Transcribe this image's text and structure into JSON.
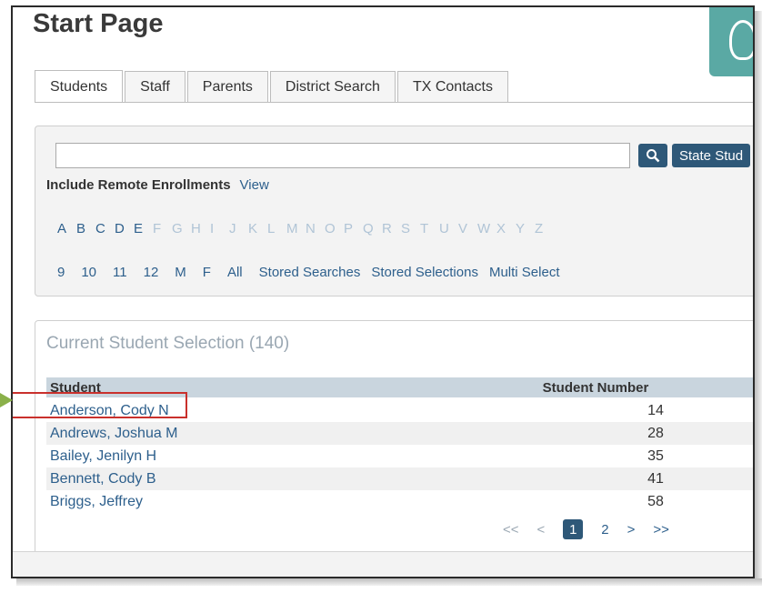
{
  "page": {
    "title": "Start Page"
  },
  "tabs": [
    {
      "label": "Students",
      "active": true
    },
    {
      "label": "Staff",
      "active": false
    },
    {
      "label": "Parents",
      "active": false
    },
    {
      "label": "District Search",
      "active": false
    },
    {
      "label": "TX Contacts",
      "active": false
    }
  ],
  "search": {
    "value": "",
    "search_icon": "search-icon",
    "state_button_label": "State Stud",
    "include_remote_label": "Include Remote Enrollments",
    "view_link": "View"
  },
  "alphabet": [
    "A",
    "B",
    "C",
    "D",
    "E",
    "F",
    "G",
    "H",
    "I",
    "J",
    "K",
    "L",
    "M",
    "N",
    "O",
    "P",
    "Q",
    "R",
    "S",
    "T",
    "U",
    "V",
    "W",
    "X",
    "Y",
    "Z"
  ],
  "grades": [
    "9",
    "10",
    "11",
    "12",
    "M",
    "F",
    "All"
  ],
  "links": {
    "stored_searches": "Stored Searches",
    "stored_selections": "Stored Selections",
    "multi_select": "Multi Select"
  },
  "results": {
    "title_prefix": "Cur",
    "title": "Current Student Selection (140)",
    "col_student": "Student",
    "col_number": "Student Number",
    "rows": [
      {
        "name": "Anderson, Cody N",
        "number": "14"
      },
      {
        "name": "Andrews, Joshua M",
        "number": "28"
      },
      {
        "name": "Bailey, Jenilyn H",
        "number": "35"
      },
      {
        "name": "Bennett, Cody B",
        "number": "41"
      },
      {
        "name": "Briggs, Jeffrey",
        "number": "58"
      }
    ],
    "pager": {
      "first": "<<",
      "prev": "<",
      "current": "1",
      "next_page": "2",
      "next": ">",
      "last": ">>"
    }
  },
  "colors": {
    "accent": "#2e5878",
    "link": "#2d5f8c",
    "highlight": "#c9302c",
    "arrow": "#8ab04a"
  }
}
